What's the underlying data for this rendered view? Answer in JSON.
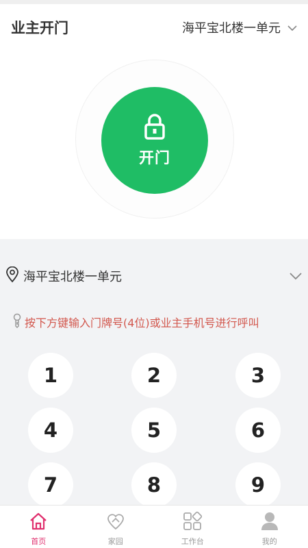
{
  "header": {
    "title": "业主开门",
    "building": "海平宝北楼一单元"
  },
  "door": {
    "button_label": "开门",
    "icon": "lock-icon",
    "color": "#1fbd65"
  },
  "location": {
    "icon": "location-pin-icon",
    "text": "海平宝北楼一单元"
  },
  "hint": {
    "icon": "key-icon",
    "text": "按下方键输入门牌号(4位)或业主手机号进行呼叫",
    "color": "#d2574d"
  },
  "keypad": {
    "keys": [
      "1",
      "2",
      "3",
      "4",
      "5",
      "6",
      "7",
      "8",
      "9"
    ]
  },
  "tabbar": {
    "active_color": "#e0306e",
    "tabs": [
      {
        "label": "首页",
        "icon": "home-icon",
        "active": true
      },
      {
        "label": "家园",
        "icon": "community-icon",
        "active": false
      },
      {
        "label": "工作台",
        "icon": "workbench-icon",
        "active": false
      },
      {
        "label": "我的",
        "icon": "profile-icon",
        "active": false
      }
    ]
  }
}
